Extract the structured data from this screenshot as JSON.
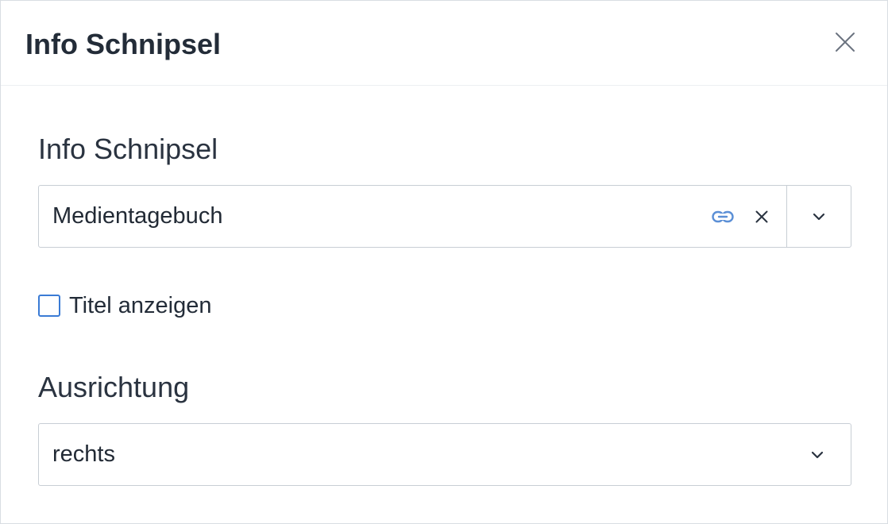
{
  "dialog": {
    "title": "Info Schnipsel",
    "close_icon": "close-icon"
  },
  "snippet_field": {
    "label": "Info Schnipsel",
    "value": "Medientagebuch",
    "icons": [
      "link-icon",
      "clear-icon",
      "chevron-down-icon"
    ],
    "link_icon_color": "#5b8fd6"
  },
  "show_title": {
    "label": "Titel anzeigen",
    "checked": false,
    "accent_color": "#3a7bd5"
  },
  "alignment_field": {
    "label": "Ausrichtung",
    "value": "rechts",
    "icon": "chevron-down-icon"
  }
}
